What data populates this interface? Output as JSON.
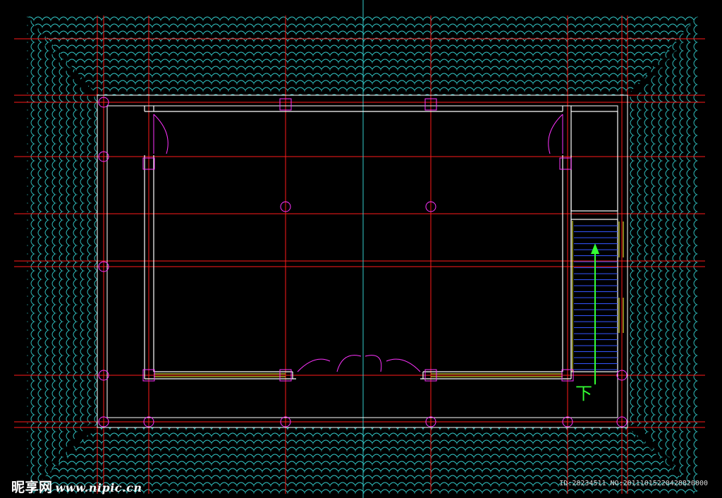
{
  "drawing": {
    "stair_direction_label": "下",
    "watermark_brand": "昵享网",
    "watermark_site": "www.nipic.cn",
    "id_line": "ID:28234511 NO:20111015220428820000"
  },
  "colors": {
    "background": "#000000",
    "grid_line": "#ff1a1a",
    "center_line": "#33cccc",
    "roof_tile": "#33cccc",
    "wall": "#ffffff",
    "column": "#ff33ff",
    "window": "#ffff33",
    "stair_tread": "#3355ff",
    "stair_arrow": "#33ff33",
    "door": "#ff33ff"
  }
}
